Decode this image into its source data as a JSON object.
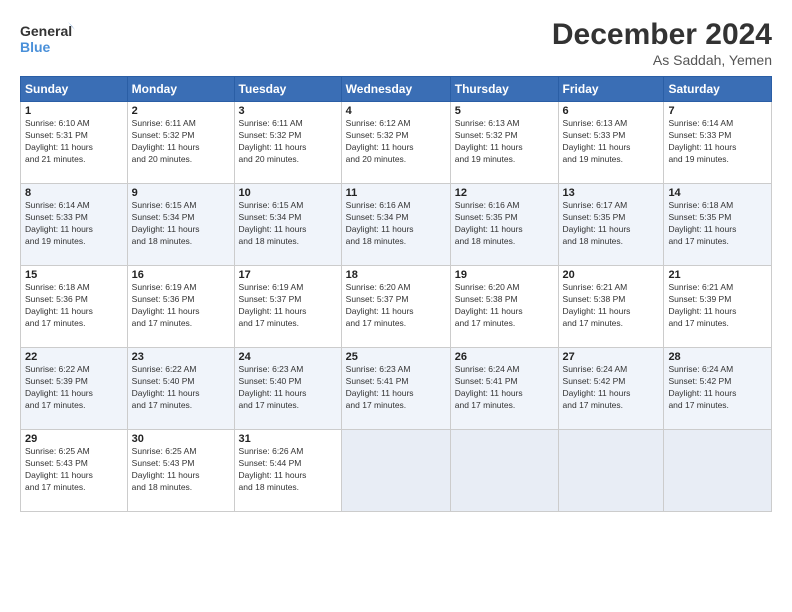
{
  "logo": {
    "line1": "General",
    "line2": "Blue"
  },
  "title": "December 2024",
  "location": "As Saddah, Yemen",
  "days_of_week": [
    "Sunday",
    "Monday",
    "Tuesday",
    "Wednesday",
    "Thursday",
    "Friday",
    "Saturday"
  ],
  "weeks": [
    [
      {
        "day": "1",
        "info": "Sunrise: 6:10 AM\nSunset: 5:31 PM\nDaylight: 11 hours\nand 21 minutes."
      },
      {
        "day": "2",
        "info": "Sunrise: 6:11 AM\nSunset: 5:32 PM\nDaylight: 11 hours\nand 20 minutes."
      },
      {
        "day": "3",
        "info": "Sunrise: 6:11 AM\nSunset: 5:32 PM\nDaylight: 11 hours\nand 20 minutes."
      },
      {
        "day": "4",
        "info": "Sunrise: 6:12 AM\nSunset: 5:32 PM\nDaylight: 11 hours\nand 20 minutes."
      },
      {
        "day": "5",
        "info": "Sunrise: 6:13 AM\nSunset: 5:32 PM\nDaylight: 11 hours\nand 19 minutes."
      },
      {
        "day": "6",
        "info": "Sunrise: 6:13 AM\nSunset: 5:33 PM\nDaylight: 11 hours\nand 19 minutes."
      },
      {
        "day": "7",
        "info": "Sunrise: 6:14 AM\nSunset: 5:33 PM\nDaylight: 11 hours\nand 19 minutes."
      }
    ],
    [
      {
        "day": "8",
        "info": "Sunrise: 6:14 AM\nSunset: 5:33 PM\nDaylight: 11 hours\nand 19 minutes."
      },
      {
        "day": "9",
        "info": "Sunrise: 6:15 AM\nSunset: 5:34 PM\nDaylight: 11 hours\nand 18 minutes."
      },
      {
        "day": "10",
        "info": "Sunrise: 6:15 AM\nSunset: 5:34 PM\nDaylight: 11 hours\nand 18 minutes."
      },
      {
        "day": "11",
        "info": "Sunrise: 6:16 AM\nSunset: 5:34 PM\nDaylight: 11 hours\nand 18 minutes."
      },
      {
        "day": "12",
        "info": "Sunrise: 6:16 AM\nSunset: 5:35 PM\nDaylight: 11 hours\nand 18 minutes."
      },
      {
        "day": "13",
        "info": "Sunrise: 6:17 AM\nSunset: 5:35 PM\nDaylight: 11 hours\nand 18 minutes."
      },
      {
        "day": "14",
        "info": "Sunrise: 6:18 AM\nSunset: 5:35 PM\nDaylight: 11 hours\nand 17 minutes."
      }
    ],
    [
      {
        "day": "15",
        "info": "Sunrise: 6:18 AM\nSunset: 5:36 PM\nDaylight: 11 hours\nand 17 minutes."
      },
      {
        "day": "16",
        "info": "Sunrise: 6:19 AM\nSunset: 5:36 PM\nDaylight: 11 hours\nand 17 minutes."
      },
      {
        "day": "17",
        "info": "Sunrise: 6:19 AM\nSunset: 5:37 PM\nDaylight: 11 hours\nand 17 minutes."
      },
      {
        "day": "18",
        "info": "Sunrise: 6:20 AM\nSunset: 5:37 PM\nDaylight: 11 hours\nand 17 minutes."
      },
      {
        "day": "19",
        "info": "Sunrise: 6:20 AM\nSunset: 5:38 PM\nDaylight: 11 hours\nand 17 minutes."
      },
      {
        "day": "20",
        "info": "Sunrise: 6:21 AM\nSunset: 5:38 PM\nDaylight: 11 hours\nand 17 minutes."
      },
      {
        "day": "21",
        "info": "Sunrise: 6:21 AM\nSunset: 5:39 PM\nDaylight: 11 hours\nand 17 minutes."
      }
    ],
    [
      {
        "day": "22",
        "info": "Sunrise: 6:22 AM\nSunset: 5:39 PM\nDaylight: 11 hours\nand 17 minutes."
      },
      {
        "day": "23",
        "info": "Sunrise: 6:22 AM\nSunset: 5:40 PM\nDaylight: 11 hours\nand 17 minutes."
      },
      {
        "day": "24",
        "info": "Sunrise: 6:23 AM\nSunset: 5:40 PM\nDaylight: 11 hours\nand 17 minutes."
      },
      {
        "day": "25",
        "info": "Sunrise: 6:23 AM\nSunset: 5:41 PM\nDaylight: 11 hours\nand 17 minutes."
      },
      {
        "day": "26",
        "info": "Sunrise: 6:24 AM\nSunset: 5:41 PM\nDaylight: 11 hours\nand 17 minutes."
      },
      {
        "day": "27",
        "info": "Sunrise: 6:24 AM\nSunset: 5:42 PM\nDaylight: 11 hours\nand 17 minutes."
      },
      {
        "day": "28",
        "info": "Sunrise: 6:24 AM\nSunset: 5:42 PM\nDaylight: 11 hours\nand 17 minutes."
      }
    ],
    [
      {
        "day": "29",
        "info": "Sunrise: 6:25 AM\nSunset: 5:43 PM\nDaylight: 11 hours\nand 17 minutes."
      },
      {
        "day": "30",
        "info": "Sunrise: 6:25 AM\nSunset: 5:43 PM\nDaylight: 11 hours\nand 18 minutes."
      },
      {
        "day": "31",
        "info": "Sunrise: 6:26 AM\nSunset: 5:44 PM\nDaylight: 11 hours\nand 18 minutes."
      },
      {
        "day": "",
        "info": ""
      },
      {
        "day": "",
        "info": ""
      },
      {
        "day": "",
        "info": ""
      },
      {
        "day": "",
        "info": ""
      }
    ]
  ]
}
